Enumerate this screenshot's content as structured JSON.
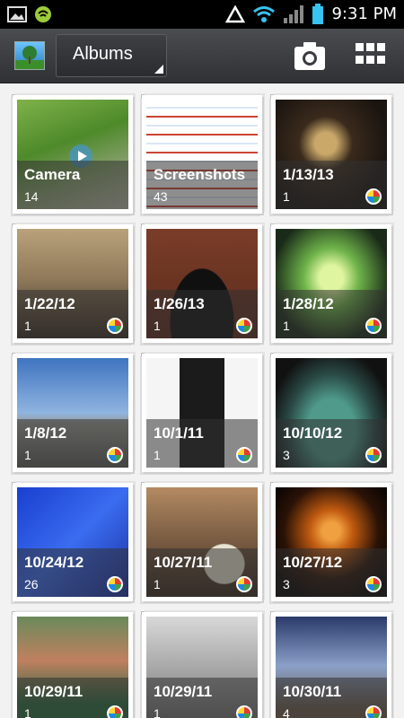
{
  "status_bar": {
    "time": "9:31 PM"
  },
  "app_bar": {
    "dropdown_label": "Albums",
    "camera_icon": "camera-icon",
    "grid_icon": "grid-view-icon"
  },
  "albums": [
    {
      "title": "Camera",
      "count": "14"
    },
    {
      "title": "Screenshots",
      "count": "43"
    },
    {
      "title": "1/13/13",
      "count": "1"
    },
    {
      "title": "1/22/12",
      "count": "1"
    },
    {
      "title": "1/26/13",
      "count": "1"
    },
    {
      "title": "1/28/12",
      "count": "1"
    },
    {
      "title": "1/8/12",
      "count": "1"
    },
    {
      "title": "10/1/11",
      "count": "1"
    },
    {
      "title": "10/10/12",
      "count": "3"
    },
    {
      "title": "10/24/12",
      "count": "26"
    },
    {
      "title": "10/27/11",
      "count": "1"
    },
    {
      "title": "10/27/12",
      "count": "3"
    },
    {
      "title": "10/29/11",
      "count": "1"
    },
    {
      "title": "10/29/11",
      "count": "1"
    },
    {
      "title": "10/30/11",
      "count": "4"
    }
  ]
}
